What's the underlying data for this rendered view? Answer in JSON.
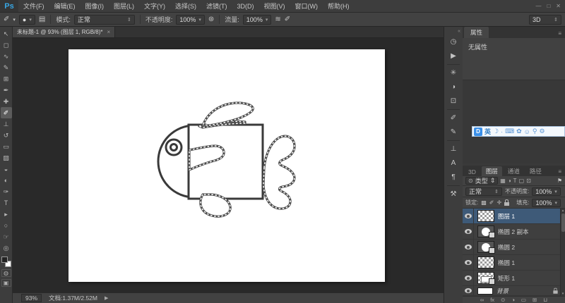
{
  "colors": {
    "accent_blue": "#38a6e3",
    "layer_selection": "#3e5a78",
    "ime_blue": "#3a8fe8"
  },
  "app": {
    "logo": "Ps",
    "window_min": "—",
    "window_restore": "□",
    "window_close": "✕",
    "workspace": "3D"
  },
  "menu": {
    "items": [
      "文件(F)",
      "编辑(E)",
      "图像(I)",
      "图层(L)",
      "文字(Y)",
      "选择(S)",
      "滤镜(T)",
      "3D(D)",
      "视图(V)",
      "窗口(W)",
      "帮助(H)"
    ]
  },
  "options": {
    "tool_glyph": "✐",
    "preset_dot": "●",
    "panel_toggle": "▤",
    "mode_label": "模式:",
    "mode_value": "正常",
    "opacity_label": "不透明度:",
    "opacity_value": "100%",
    "pressure_icon": "⊛",
    "flow_label": "流量:",
    "flow_value": "100%",
    "airbrush_icon": "≋",
    "pressure_size_icon": "✐"
  },
  "ui": {
    "caret": "▾",
    "spin": "⇕",
    "menu": "≡",
    "collapse": "«",
    "arrow_right": "▶",
    "scroll_up": "▴",
    "scroll_down": "▾"
  },
  "tools": [
    {
      "name": "move-tool",
      "glyph": "↖"
    },
    {
      "name": "marquee-tool",
      "glyph": "◻"
    },
    {
      "name": "lasso-tool",
      "glyph": "∿"
    },
    {
      "name": "quick-select-tool",
      "glyph": "✎"
    },
    {
      "name": "crop-tool",
      "glyph": "⊞"
    },
    {
      "name": "eyedropper-tool",
      "glyph": "✒"
    },
    {
      "name": "healing-brush-tool",
      "glyph": "✚"
    },
    {
      "name": "brush-tool",
      "glyph": "✐"
    },
    {
      "name": "clone-stamp-tool",
      "glyph": "⊥"
    },
    {
      "name": "history-brush-tool",
      "glyph": "↺"
    },
    {
      "name": "eraser-tool",
      "glyph": "▭"
    },
    {
      "name": "gradient-tool",
      "glyph": "▨"
    },
    {
      "name": "blur-tool",
      "glyph": "◒"
    },
    {
      "name": "dodge-tool",
      "glyph": "◐"
    },
    {
      "name": "pen-tool",
      "glyph": "✑"
    },
    {
      "name": "type-tool",
      "glyph": "T"
    },
    {
      "name": "path-select-tool",
      "glyph": "▸"
    },
    {
      "name": "shape-tool",
      "glyph": "○"
    },
    {
      "name": "hand-tool",
      "glyph": "☞"
    },
    {
      "name": "zoom-tool",
      "glyph": "◎"
    }
  ],
  "doc": {
    "tab_title": "未标题-1 @ 93% (图层 1, RGB/8)*",
    "tab_close": "×"
  },
  "status": {
    "zoom": "93%",
    "doc_info": "文档:1.37M/2.52M"
  },
  "dock_icons": [
    {
      "name": "history-panel-icon",
      "glyph": "◷"
    },
    {
      "name": "actions-panel-icon",
      "glyph": "▶"
    },
    {
      "name": "styles-panel-icon",
      "glyph": "✳"
    },
    {
      "name": "adjustments-panel-icon",
      "glyph": "◑"
    },
    {
      "name": "masks-panel-icon",
      "glyph": "⊡"
    },
    {
      "name": "brush-presets-panel-icon",
      "glyph": "✐"
    },
    {
      "name": "brush-panel-icon",
      "glyph": "✎"
    },
    {
      "name": "clone-source-panel-icon",
      "glyph": "⊥"
    },
    {
      "name": "character-panel-icon",
      "glyph": "A"
    },
    {
      "name": "paragraph-panel-icon",
      "glyph": "¶"
    },
    {
      "name": "tool-presets-panel-icon",
      "glyph": "⚒"
    }
  ],
  "props": {
    "tab": "属性",
    "content": "无属性"
  },
  "ime": {
    "mode": "英",
    "icons": [
      {
        "name": "ime-moon-icon",
        "glyph": "☽"
      },
      {
        "name": "ime-dot-icon",
        "glyph": "·"
      },
      {
        "name": "ime-keyboard-icon",
        "glyph": "⌨"
      },
      {
        "name": "ime-skin-icon",
        "glyph": "✿"
      },
      {
        "name": "ime-user-icon",
        "glyph": "☺"
      },
      {
        "name": "ime-search-icon",
        "glyph": "⚲"
      },
      {
        "name": "ime-settings-icon",
        "glyph": "⚙"
      }
    ]
  },
  "layers": {
    "tabs": [
      "3D",
      "图层",
      "通道",
      "路径"
    ],
    "filter": {
      "search": "⊙",
      "label": "类型",
      "icons": [
        {
          "name": "filter-pixel-icon",
          "glyph": "▦"
        },
        {
          "name": "filter-adjustment-icon",
          "glyph": "◑"
        },
        {
          "name": "filter-type-icon",
          "glyph": "T"
        },
        {
          "name": "filter-shape-icon",
          "glyph": "▢"
        },
        {
          "name": "filter-smartobject-icon",
          "glyph": "⊡"
        }
      ],
      "toggle": "⚑"
    },
    "blend_mode": "正常",
    "opacity_label": "不透明度:",
    "opacity_value": "100%",
    "lock_label": "锁定:",
    "lock_icons": [
      {
        "name": "lock-transparent-icon",
        "glyph": "▩"
      },
      {
        "name": "lock-pixels-icon",
        "glyph": "✐"
      },
      {
        "name": "lock-position-icon",
        "glyph": "✛"
      }
    ],
    "fill_label": "填充:",
    "fill_value": "100%",
    "items": [
      {
        "name": "图层 1",
        "selected": true
      },
      {
        "name": "椭圆 2 副本"
      },
      {
        "name": "椭圆 2"
      },
      {
        "name": "椭圆 1"
      },
      {
        "name": "矩形 1"
      },
      {
        "name": "背景",
        "locked": true
      }
    ],
    "buttons": [
      {
        "name": "link-layers-button",
        "glyph": "∞"
      },
      {
        "name": "layer-style-button",
        "glyph": "fx"
      },
      {
        "name": "add-mask-button",
        "glyph": "⊙"
      },
      {
        "name": "adjustment-layer-button",
        "glyph": "◑"
      },
      {
        "name": "new-group-button",
        "glyph": "▭"
      },
      {
        "name": "new-layer-button",
        "glyph": "⊞"
      },
      {
        "name": "delete-layer-button",
        "glyph": "⊔"
      }
    ]
  }
}
